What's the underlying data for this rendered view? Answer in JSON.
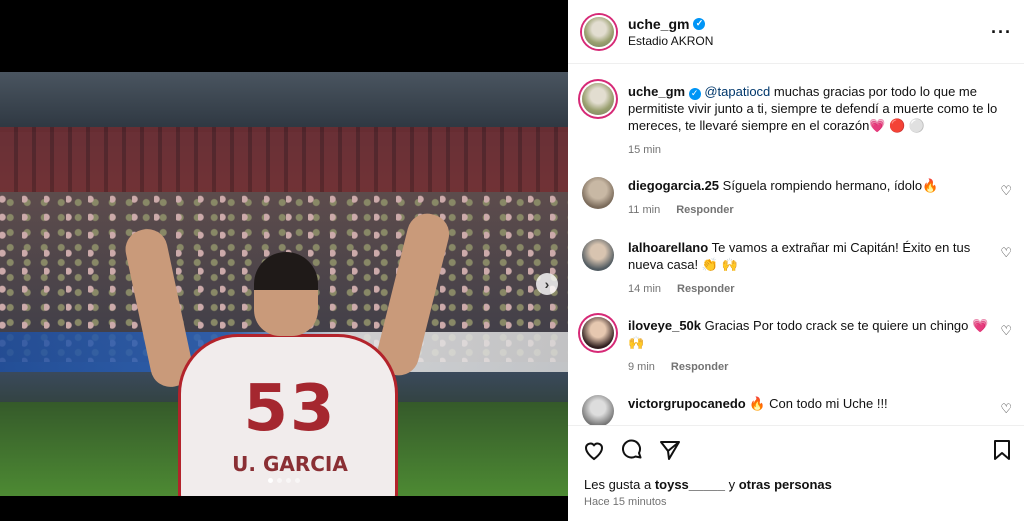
{
  "post": {
    "username": "uche_gm",
    "location": "Estadio AKRON",
    "more_label": "···",
    "jersey_number": "53",
    "jersey_name": "U. GARCIA",
    "carousel_next": "›"
  },
  "caption": {
    "username": "uche_gm",
    "mention": "@tapatiocd",
    "text": " muchas gracias por todo lo que me permitiste vivir junto a ti, siempre te defendí a muerte como te lo mereces, te llevaré siempre en el corazón💗 🔴 ⚪",
    "time": "15 min"
  },
  "comments": [
    {
      "username": "diegogarcia.25",
      "text": "Síguela rompiendo hermano, ídolo🔥",
      "time": "11 min",
      "reply": "Responder"
    },
    {
      "username": "lalhoarellano",
      "text": "Te vamos a extrañar mi Capitán! Éxito en tus nueva casa! 👏 🙌",
      "time": "14 min",
      "reply": "Responder"
    },
    {
      "username": "iloveye_50k",
      "text": "Gracias Por todo crack se te quiere un chingo 💗 🙌",
      "time": "9 min",
      "reply": "Responder"
    },
    {
      "username": "victorgrupocanedo",
      "text": "🔥 Con todo mi Uche !!!",
      "time": "",
      "reply": ""
    }
  ],
  "likes": {
    "prefix": "Les gusta a ",
    "user": "toyss_____",
    "middle": " y ",
    "others": "otras personas"
  },
  "timestamp": "Hace 15 minutos",
  "colors": {
    "verified": "#0095f6",
    "story_ring": "#d62976",
    "muted": "#737373",
    "jersey_red": "#a5272f"
  }
}
